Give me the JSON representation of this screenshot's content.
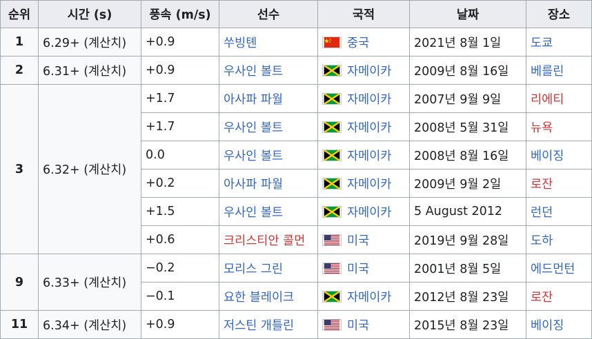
{
  "headers": [
    "순위",
    "시간 (s)",
    "풍속 (m/s)",
    "선수",
    "국적",
    "날짜",
    "장소"
  ],
  "colors": {
    "link": "#3366cc",
    "redlink": "#d73333",
    "header_bg": "#eaecf0",
    "border": "#a2a9b1"
  },
  "groups": [
    {
      "rank": "1",
      "time": "6.29+ (계산치)",
      "rows": [
        {
          "wind": "+0.9",
          "athlete": "쑤빙톈",
          "athlete_red": false,
          "flag": "china-flag-icon",
          "nation": "중국",
          "date": "2021년 8월 1일",
          "place": "도쿄",
          "place_red": false
        }
      ]
    },
    {
      "rank": "2",
      "time": "6.31+ (계산치)",
      "rows": [
        {
          "wind": "+0.9",
          "athlete": "우사인 볼트",
          "athlete_red": false,
          "flag": "jamaica-flag-icon",
          "nation": "자메이카",
          "date": "2009년 8월 16일",
          "place": "베를린",
          "place_red": false
        }
      ]
    },
    {
      "rank": "3",
      "time": "6.32+ (계산치)",
      "rows": [
        {
          "wind": "+1.7",
          "athlete": "아사파 파월",
          "athlete_red": false,
          "flag": "jamaica-flag-icon",
          "nation": "자메이카",
          "date": "2007년 9월 9일",
          "place": "리에티",
          "place_red": true
        },
        {
          "wind": "+1.7",
          "athlete": "우사인 볼트",
          "athlete_red": false,
          "flag": "jamaica-flag-icon",
          "nation": "자메이카",
          "date": "2008년 5월 31일",
          "place": "뉴욕",
          "place_red": true
        },
        {
          "wind": "0.0",
          "athlete": "우사인 볼트",
          "athlete_red": false,
          "flag": "jamaica-flag-icon",
          "nation": "자메이카",
          "date": "2008년 8월 16일",
          "place": "베이징",
          "place_red": false
        },
        {
          "wind": "+0.2",
          "athlete": "아사파 파월",
          "athlete_red": false,
          "flag": "jamaica-flag-icon",
          "nation": "자메이카",
          "date": "2009년 9월 2일",
          "place": "로잔",
          "place_red": true
        },
        {
          "wind": "+1.5",
          "athlete": "우사인 볼트",
          "athlete_red": false,
          "flag": "jamaica-flag-icon",
          "nation": "자메이카",
          "date": "5 August 2012",
          "place": "런던",
          "place_red": false
        },
        {
          "wind": "+0.6",
          "athlete": "크리스티안 콜먼",
          "athlete_red": true,
          "flag": "usa-flag-icon",
          "nation": "미국",
          "date": "2019년 9월 28일",
          "place": "도하",
          "place_red": false
        }
      ]
    },
    {
      "rank": "9",
      "time": "6.33+ (계산치)",
      "rows": [
        {
          "wind": "−0.2",
          "athlete": "모리스 그린",
          "athlete_red": false,
          "flag": "usa-flag-icon",
          "nation": "미국",
          "date": "2001년 8월 5일",
          "place": "에드먼턴",
          "place_red": false
        },
        {
          "wind": "−0.1",
          "athlete": "요한 블레이크",
          "athlete_red": false,
          "flag": "jamaica-flag-icon",
          "nation": "자메이카",
          "date": "2012년 8월 23일",
          "place": "로잔",
          "place_red": true
        }
      ]
    },
    {
      "rank": "11",
      "time": "6.34+ (계산치)",
      "rows": [
        {
          "wind": "+0.9",
          "athlete": "저스틴 개틀린",
          "athlete_red": false,
          "flag": "usa-flag-icon",
          "nation": "미국",
          "date": "2015년 8월 23일",
          "place": "베이징",
          "place_red": false
        }
      ]
    }
  ]
}
